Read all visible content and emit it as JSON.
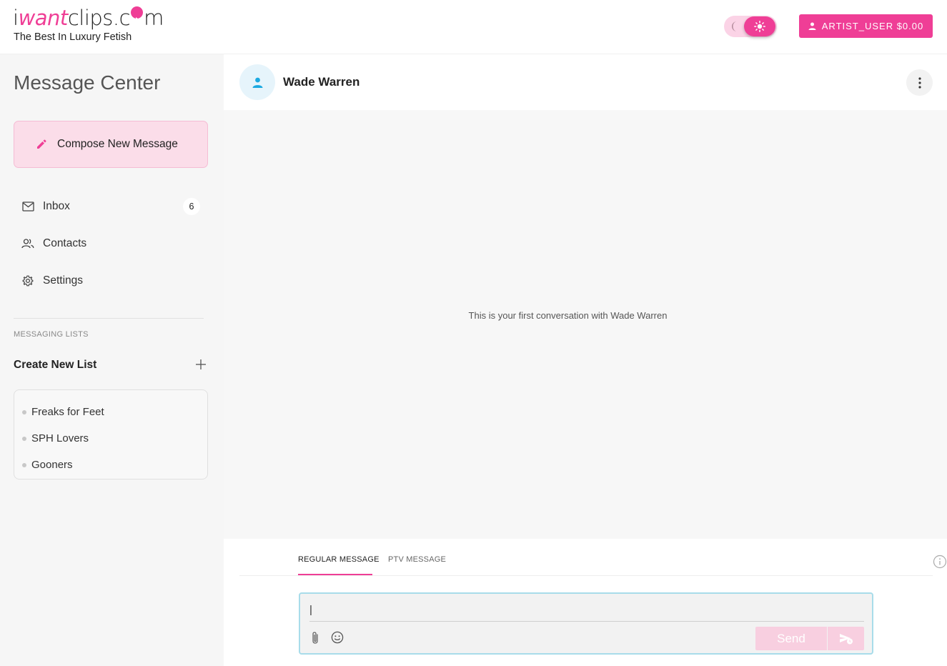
{
  "header": {
    "logo": {
      "part1": "i",
      "part2": "want",
      "part3": "clips.c",
      "part4": "m"
    },
    "tagline": "The Best In Luxury Fetish",
    "user_button": "ARTIST_USER $0.00"
  },
  "sidebar": {
    "title": "Message Center",
    "compose_label": "Compose New Message",
    "nav": [
      {
        "label": "Inbox",
        "badge": "6"
      },
      {
        "label": "Contacts"
      },
      {
        "label": "Settings"
      }
    ],
    "lists_label": "MESSAGING LISTS",
    "create_list": "Create New List",
    "lists": [
      "Freaks for Feet",
      "SPH Lovers",
      "Gooners"
    ]
  },
  "chat": {
    "contact_name": "Wade Warren",
    "empty_text": "This is your first conversation with Wade Warren",
    "tabs": [
      "REGULAR MESSAGE",
      "PTV MESSAGE"
    ],
    "input_value": "|",
    "send_label": "Send"
  },
  "colors": {
    "accent": "#ef3e96",
    "accent_light": "#fbdde9",
    "focus": "#a8dcea",
    "avatar_icon": "#1ba9e1"
  },
  "icons": [
    "moon-icon",
    "sun-icon",
    "person-icon",
    "pencil-icon",
    "mail-icon",
    "contacts-icon",
    "gear-icon",
    "plus-icon",
    "kebab-icon",
    "info-icon",
    "paperclip-icon",
    "emoji-icon",
    "scheduled-send-icon"
  ]
}
